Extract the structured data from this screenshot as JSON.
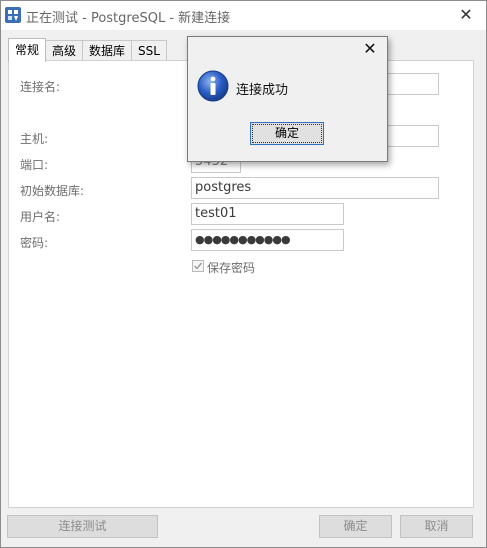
{
  "window": {
    "title": "正在测试 - PostgreSQL - 新建连接",
    "close_glyph": "✕"
  },
  "tabs": [
    {
      "label": "常规",
      "active": true
    },
    {
      "label": "高级",
      "active": false
    },
    {
      "label": "数据库",
      "active": false
    },
    {
      "label": "SSL",
      "active": false
    }
  ],
  "form": {
    "connection_name_label": "连接名:",
    "host_label": "主机:",
    "port_label": "端口:",
    "port_value": "5432",
    "initial_db_label": "初始数据库:",
    "initial_db_value": "postgres",
    "username_label": "用户名:",
    "username_value": "test01",
    "password_label": "密码:",
    "password_value": "●●●●●●●●●●●",
    "save_password_label": "保存密码",
    "save_password_checked": true
  },
  "footer": {
    "test_connection": "连接测试",
    "ok": "确定",
    "cancel": "取消"
  },
  "modal": {
    "message": "连接成功",
    "ok": "确定",
    "close_glyph": "✕",
    "icon": "info-icon"
  },
  "colors": {
    "info_blue": "#2a5cc4",
    "focus_border": "#2f6fc4"
  }
}
